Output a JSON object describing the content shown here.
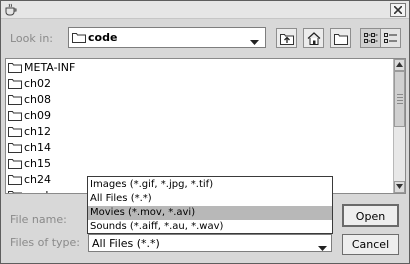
{
  "window": {
    "close_symbol": "✕",
    "app_icon": "java-cup-icon"
  },
  "lookin": {
    "label": "Look in:",
    "value": "code"
  },
  "toolbar": {
    "up_icon": "up-folder-icon",
    "home_icon": "home-icon",
    "new_folder_icon": "new-folder-icon",
    "list_icon": "list-view-icon",
    "details_icon": "details-view-icon",
    "list_view_selected": true
  },
  "files": [
    {
      "name": "META-INF"
    },
    {
      "name": "ch02"
    },
    {
      "name": "ch08"
    },
    {
      "name": "ch09"
    },
    {
      "name": "ch12"
    },
    {
      "name": "ch14"
    },
    {
      "name": "ch15"
    },
    {
      "name": "ch24"
    },
    {
      "name": "mml"
    }
  ],
  "filename": {
    "label": "File name:",
    "value": ""
  },
  "filetype": {
    "label": "Files of type:",
    "value": "All Files (*.*)",
    "options": [
      "Images (*.gif, *.jpg, *.tif)",
      "All Files (*.*)",
      "Movies (*.mov, *.avi)",
      "Sounds (*.aiff, *.au, *.wav)"
    ],
    "highlighted_option": "Movies (*.mov, *.avi)"
  },
  "buttons": {
    "open": "Open",
    "cancel": "Cancel"
  },
  "colors": {
    "window_bg": "#d8d8d8",
    "list_bg": "#ffffff",
    "highlight": "#b8b8b8",
    "label_gray": "#8a8a8a"
  }
}
